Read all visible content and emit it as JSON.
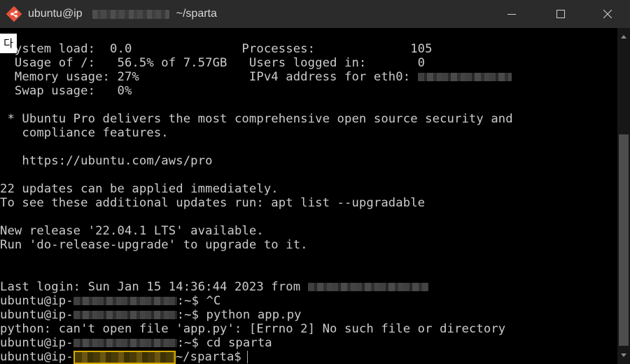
{
  "window": {
    "title_prefix": "ubuntu@ip",
    "title_suffix": "~/sparta",
    "icon": "git-bash-diamond-icon",
    "controls": [
      "minimize-icon",
      "maximize-icon",
      "close-icon"
    ]
  },
  "ime_indicator": "다",
  "terminal": {
    "lines": [
      " System load:  0.0               Processes:             105",
      "  Usage of /:   56.5% of 7.57GB   Users logged in:       0",
      "  Memory usage: 27%               IPv4 address for eth0: ",
      "  Swap usage:   0%",
      "",
      " * Ubuntu Pro delivers the most comprehensive open source security and",
      "   compliance features.",
      "",
      "   https://ubuntu.com/aws/pro",
      "",
      "22 updates can be applied immediately.",
      "To see these additional updates run: apt list --upgradable",
      "",
      "New release '22.04.1 LTS' available.",
      "Run 'do-release-upgrade' to upgrade to it.",
      "",
      "",
      "Last login: Sun Jan 15 14:36:44 2023 from ",
      "",
      "",
      "python: can't open file 'app.py': [Errno 2] No such file or directory",
      "",
      ""
    ],
    "prompt_user": "ubuntu@ip-",
    "prompts": [
      {
        "suffix": ":~$ ^C"
      },
      {
        "suffix": ":~$ python app.py"
      },
      {
        "suffix": ":~$ cd sparta"
      },
      {
        "suffix": "~/sparta$"
      }
    ]
  },
  "colors": {
    "background": "#000000",
    "text": "#cccccc",
    "titlebar": "#2b2b2b",
    "highlight": "#d6a800"
  }
}
